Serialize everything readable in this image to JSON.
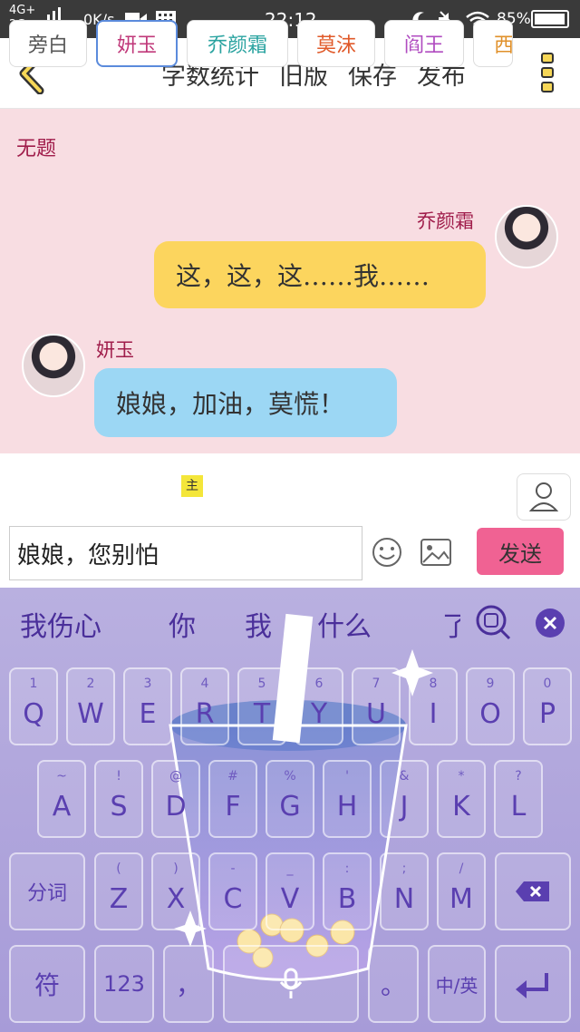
{
  "status_bar": {
    "net_top": "4G+",
    "net_bottom": "2G",
    "speed": "0K/s",
    "time": "22:12",
    "battery": "85%"
  },
  "app_bar": {
    "actions": [
      "字数统计",
      "旧版",
      "保存",
      "发布"
    ]
  },
  "document": {
    "title": "无题"
  },
  "messages": [
    {
      "side": "right",
      "name": "乔颜霜",
      "text": "这，这，这……我……"
    },
    {
      "side": "left",
      "name": "妍玉",
      "text": "娘娘，加油，莫慌！"
    }
  ],
  "roles": {
    "items": [
      "旁白",
      "妍玉",
      "乔颜霜",
      "莫沫",
      "阎王",
      "西"
    ],
    "tag": "主"
  },
  "composer": {
    "value": "娘娘，您别怕",
    "send_label": "发送"
  },
  "keyboard": {
    "candidates": [
      "我伤心",
      "你",
      "我",
      "什么",
      "了"
    ],
    "row1": [
      {
        "sub": "1",
        "main": "Q"
      },
      {
        "sub": "2",
        "main": "W"
      },
      {
        "sub": "3",
        "main": "E"
      },
      {
        "sub": "4",
        "main": "R"
      },
      {
        "sub": "5",
        "main": "T"
      },
      {
        "sub": "6",
        "main": "Y"
      },
      {
        "sub": "7",
        "main": "U"
      },
      {
        "sub": "8",
        "main": "I"
      },
      {
        "sub": "9",
        "main": "O"
      },
      {
        "sub": "0",
        "main": "P"
      }
    ],
    "row2": [
      {
        "sub": "~",
        "main": "A"
      },
      {
        "sub": "!",
        "main": "S"
      },
      {
        "sub": "@",
        "main": "D"
      },
      {
        "sub": "#",
        "main": "F"
      },
      {
        "sub": "%",
        "main": "G"
      },
      {
        "sub": "'",
        "main": "H"
      },
      {
        "sub": "&",
        "main": "J"
      },
      {
        "sub": "*",
        "main": "K"
      },
      {
        "sub": "?",
        "main": "L"
      }
    ],
    "row3": [
      {
        "sub": "(",
        "main": "Z"
      },
      {
        "sub": ")",
        "main": "X"
      },
      {
        "sub": "-",
        "main": "C"
      },
      {
        "sub": "_",
        "main": "V"
      },
      {
        "sub": ":",
        "main": "B"
      },
      {
        "sub": ";",
        "main": "N"
      },
      {
        "sub": "/",
        "main": "M"
      }
    ],
    "split_label": "分词",
    "symbol_label": "符",
    "number_label": "123",
    "comma_label": "，",
    "period_label": "。",
    "lang_label": "中/英"
  }
}
